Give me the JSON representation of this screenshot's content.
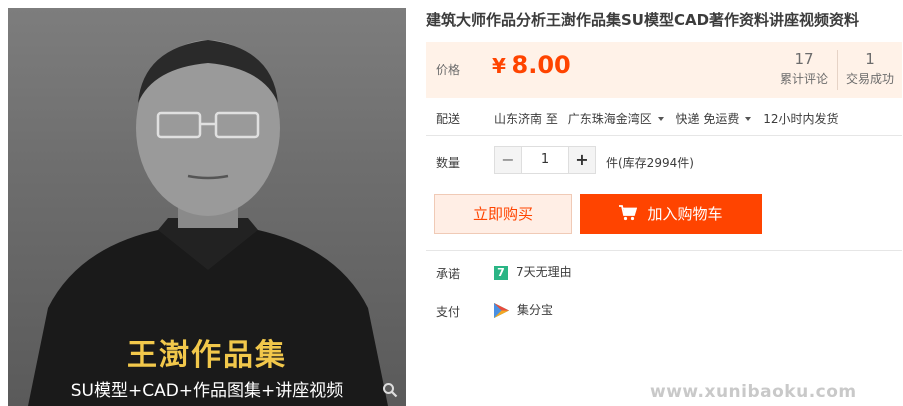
{
  "product": {
    "title": "建筑大师作品分析王澍作品集SU模型CAD著作资料讲座视频资料",
    "image_caption_main": "王澍作品集",
    "image_caption_sub": "SU模型+CAD+作品图集+讲座视频"
  },
  "price": {
    "label": "价格",
    "currency": "¥",
    "value": "8.00",
    "reviews_count": "17",
    "reviews_label": "累计评论",
    "sales_count": "1",
    "sales_label": "交易成功"
  },
  "delivery": {
    "label": "配送",
    "from": "山东济南",
    "to_word": "至",
    "destination": "广东珠海金湾区",
    "method": "快递 免运费",
    "ship_time": "12小时内发货"
  },
  "quantity": {
    "label": "数量",
    "minus": "−",
    "value": "1",
    "plus": "+",
    "stock_text": "件(库存2994件)"
  },
  "actions": {
    "buy_now": "立即购买",
    "add_to_cart": "加入购物车"
  },
  "promise": {
    "label": "承诺",
    "badge": "7",
    "text": "7天无理由"
  },
  "payment": {
    "label": "支付",
    "text": "集分宝"
  },
  "watermark": "www.xunibaoku.com",
  "colors": {
    "accent": "#ff4400",
    "price_bg": "#fff2e8",
    "promise_badge": "#2ab585"
  }
}
